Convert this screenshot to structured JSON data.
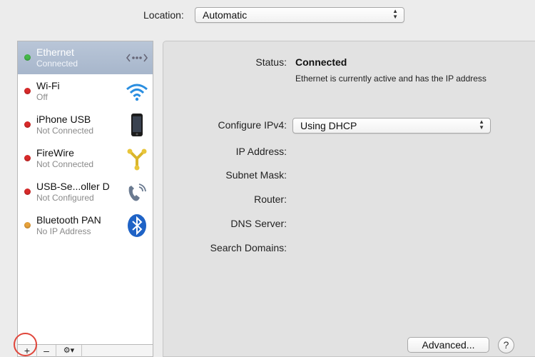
{
  "location": {
    "label": "Location:",
    "value": "Automatic"
  },
  "services": [
    {
      "name": "Ethernet",
      "status": "Connected",
      "dot_color": "#45b84a",
      "icon": "ethernet-icon",
      "selected": true
    },
    {
      "name": "Wi-Fi",
      "status": "Off",
      "dot_color": "#d92a2a",
      "icon": "wifi-icon",
      "selected": false
    },
    {
      "name": "iPhone USB",
      "status": "Not Connected",
      "dot_color": "#d92a2a",
      "icon": "iphone-icon",
      "selected": false
    },
    {
      "name": "FireWire",
      "status": "Not Connected",
      "dot_color": "#d92a2a",
      "icon": "firewire-icon",
      "selected": false
    },
    {
      "name": "USB-Se...oller D",
      "status": "Not Configured",
      "dot_color": "#d92a2a",
      "icon": "usb-serial-icon",
      "selected": false
    },
    {
      "name": "Bluetooth PAN",
      "status": "No IP Address",
      "dot_color": "#e8a23a",
      "icon": "bluetooth-icon",
      "selected": false
    }
  ],
  "sidebar_footer": {
    "add": "+",
    "remove": "–",
    "action": "⚙▾"
  },
  "detail": {
    "status_label": "Status:",
    "status_value": "Connected",
    "status_description": "Ethernet is currently active and has the IP address",
    "configure_label": "Configure IPv4:",
    "configure_value": "Using DHCP",
    "ip_label": "IP Address:",
    "subnet_label": "Subnet Mask:",
    "router_label": "Router:",
    "dns_label": "DNS Server:",
    "search_label": "Search Domains:",
    "advanced_button": "Advanced...",
    "help_button": "?"
  },
  "colors": {
    "selection": "#a9b8cc",
    "highlight_ring": "#e0453a"
  }
}
